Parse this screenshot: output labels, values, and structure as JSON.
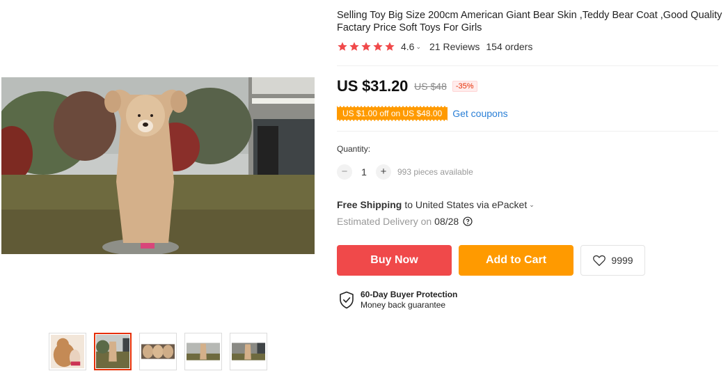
{
  "product": {
    "title": "Selling Toy Big Size 200cm American Giant Bear Skin ,Teddy Bear Coat ,Good Quality Factary Price Soft Toys For Girls",
    "rating": "4.6",
    "stars": 5,
    "reviews": "21 Reviews",
    "orders": "154 orders"
  },
  "pricing": {
    "price": "US $31.20",
    "original_price": "US $48",
    "discount": "-35%",
    "coupon": "US $1.00 off on US $48.00",
    "get_coupons": "Get coupons"
  },
  "quantity": {
    "label": "Quantity:",
    "minus": "−",
    "value": "1",
    "plus": "+",
    "available": "993 pieces available"
  },
  "shipping": {
    "free_label": "Free Shipping",
    "destination": "to United States via ePacket",
    "delivery_label": "Estimated Delivery on",
    "delivery_date": "08/28"
  },
  "actions": {
    "buy_now": "Buy Now",
    "add_to_cart": "Add to Cart",
    "wishlist_count": "9999"
  },
  "protection": {
    "title": "60-Day Buyer Protection",
    "subtitle": "Money back guarantee"
  },
  "gallery": {
    "selected_index": 1,
    "thumb_count": 5
  },
  "colors": {
    "star": "#f0494a",
    "buy_now": "#f0494a",
    "add_to_cart": "#ff9a00",
    "coupon": "#ff9a00",
    "link": "#2a7fd6",
    "discount": "#e62e04"
  }
}
